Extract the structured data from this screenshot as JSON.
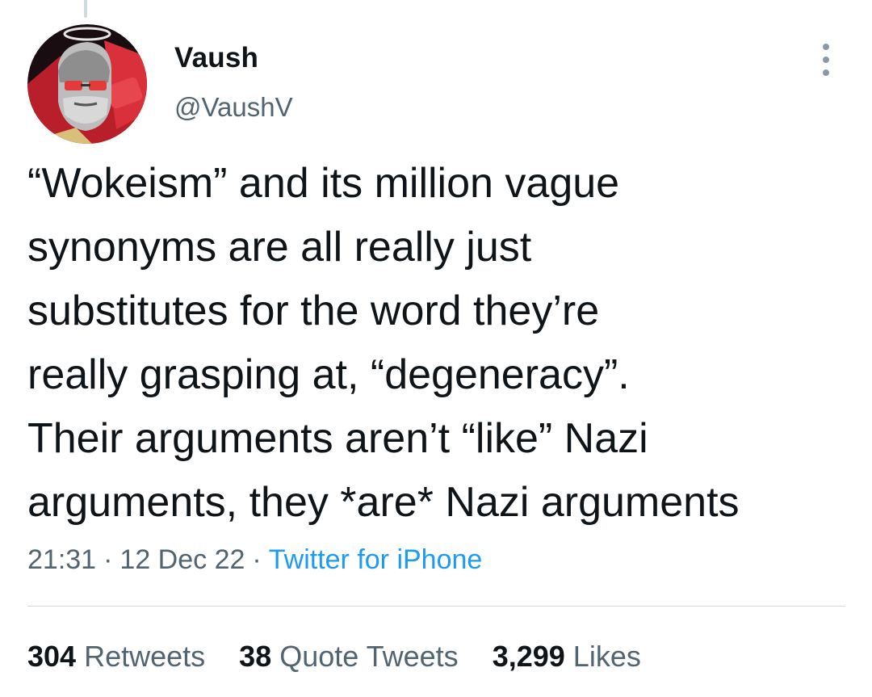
{
  "author": {
    "display_name": "Vaush",
    "handle": "@VaushV",
    "avatar_icon": "profile-avatar"
  },
  "tweet": {
    "lines": [
      "“Wokeism” and its million vague",
      "synonyms are all really just",
      "substitutes for the word they’re",
      "really grasping at, “degeneracy”.",
      "Their arguments aren’t “like” Nazi",
      "arguments, they *are* Nazi arguments"
    ],
    "time": "21:31",
    "date": "12 Dec 22",
    "separator": "·",
    "source": "Twitter for iPhone"
  },
  "stats": {
    "retweets": {
      "count": "304",
      "label": "Retweets"
    },
    "quote_tweets": {
      "count": "38",
      "label": "Quote Tweets"
    },
    "likes": {
      "count": "3,299",
      "label": "Likes"
    }
  },
  "colors": {
    "text": "#0f1419",
    "secondary": "#536471",
    "link": "#1d9bf0",
    "divider": "#cfd9de"
  },
  "icons": {
    "more": "more-options-icon"
  }
}
